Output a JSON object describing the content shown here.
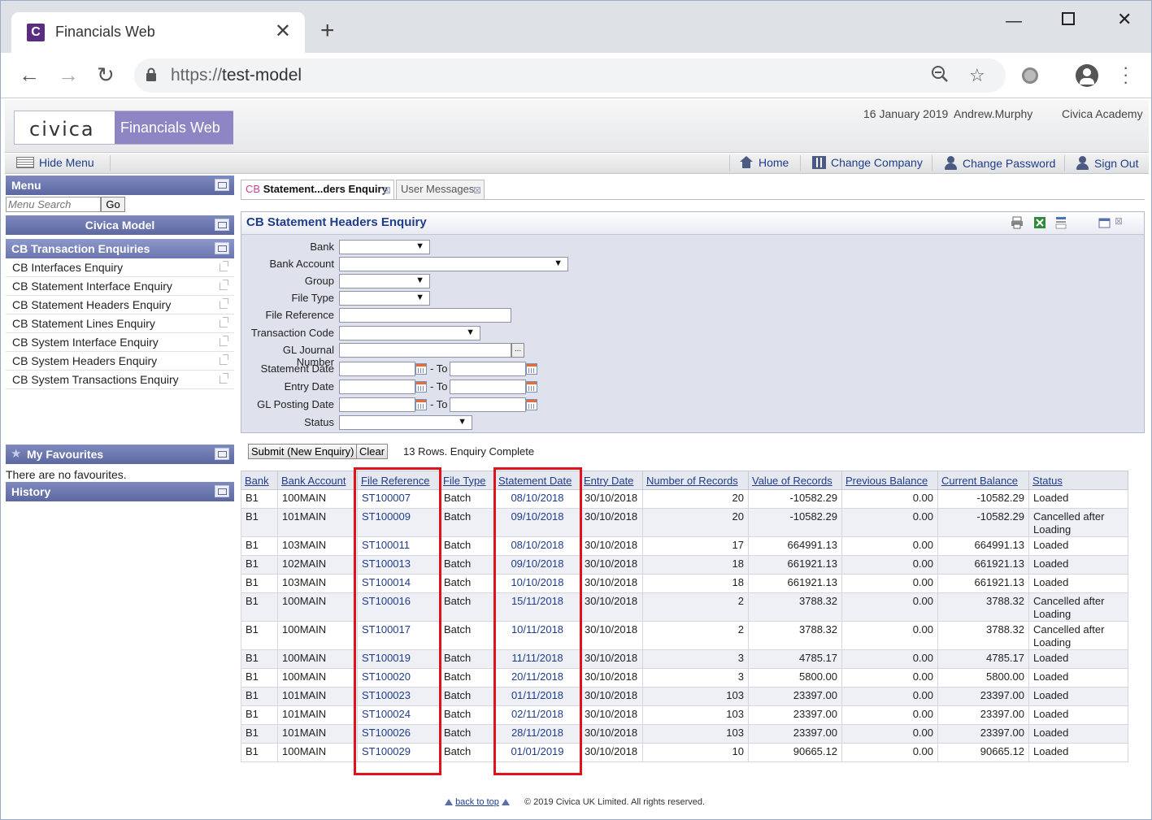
{
  "browser": {
    "tab_title": "Financials Web",
    "favicon_letter": "C",
    "url_scheme": "https://",
    "url_host": "test-model"
  },
  "app": {
    "logo_text": "civica",
    "product": "Financials Web",
    "date": "16 January 2019",
    "user": "Andrew.Murphy",
    "company": "Civica Academy"
  },
  "toolbar": {
    "hide_menu": "Hide Menu",
    "home": "Home",
    "change_company": "Change Company",
    "change_password": "Change Password",
    "sign_out": "Sign Out"
  },
  "sidebar": {
    "menu_title": "Menu",
    "search_placeholder": "Menu Search",
    "go": "Go",
    "section_model": "Civica Model",
    "section_enquiries": "CB Transaction Enquiries",
    "items": [
      "CB Interfaces Enquiry",
      "CB Statement Interface Enquiry",
      "CB Statement Headers Enquiry",
      "CB Statement Lines Enquiry",
      "CB System Interface Enquiry",
      "CB System Headers Enquiry",
      "CB System Transactions Enquiry"
    ],
    "favourites_title": "My Favourites",
    "favourites_empty": "There are no favourites.",
    "history_title": "History"
  },
  "tabs": {
    "active_prefix": "CB",
    "active_label": "Statement...ders Enquiry",
    "messages": "User Messages"
  },
  "enquiry": {
    "title": "CB Statement Headers Enquiry",
    "labels": {
      "bank": "Bank",
      "bank_account": "Bank Account",
      "group": "Group",
      "file_type": "File Type",
      "file_reference": "File Reference",
      "transaction_code": "Transaction Code",
      "gl_journal": "GL Journal Number",
      "statement_date": "Statement Date",
      "entry_date": "Entry Date",
      "gl_posting_date": "GL Posting Date",
      "status": "Status",
      "to": "- To"
    },
    "submit": "Submit (New Enquiry)",
    "clear": "Clear",
    "result_message": "13 Rows. Enquiry Complete"
  },
  "table": {
    "headers": [
      "Bank",
      "Bank Account",
      "File Reference",
      "File Type",
      "Statement Date",
      "Entry Date",
      "Number of Records",
      "Value of Records",
      "Previous Balance",
      "Current Balance",
      "Status"
    ],
    "rows": [
      [
        "B1",
        "100MAIN",
        "ST100007",
        "Batch",
        "08/10/2018",
        "30/10/2018",
        "20",
        "-10582.29",
        "0.00",
        "-10582.29",
        "Loaded"
      ],
      [
        "B1",
        "101MAIN",
        "ST100009",
        "Batch",
        "09/10/2018",
        "30/10/2018",
        "20",
        "-10582.29",
        "0.00",
        "-10582.29",
        "Cancelled after Loading"
      ],
      [
        "B1",
        "103MAIN",
        "ST100011",
        "Batch",
        "08/10/2018",
        "30/10/2018",
        "17",
        "664991.13",
        "0.00",
        "664991.13",
        "Loaded"
      ],
      [
        "B1",
        "102MAIN",
        "ST100013",
        "Batch",
        "09/10/2018",
        "30/10/2018",
        "18",
        "661921.13",
        "0.00",
        "661921.13",
        "Loaded"
      ],
      [
        "B1",
        "103MAIN",
        "ST100014",
        "Batch",
        "10/10/2018",
        "30/10/2018",
        "18",
        "661921.13",
        "0.00",
        "661921.13",
        "Loaded"
      ],
      [
        "B1",
        "100MAIN",
        "ST100016",
        "Batch",
        "15/11/2018",
        "30/10/2018",
        "2",
        "3788.32",
        "0.00",
        "3788.32",
        "Cancelled after Loading"
      ],
      [
        "B1",
        "100MAIN",
        "ST100017",
        "Batch",
        "10/11/2018",
        "30/10/2018",
        "2",
        "3788.32",
        "0.00",
        "3788.32",
        "Cancelled after Loading"
      ],
      [
        "B1",
        "100MAIN",
        "ST100019",
        "Batch",
        "11/11/2018",
        "30/10/2018",
        "3",
        "4785.17",
        "0.00",
        "4785.17",
        "Loaded"
      ],
      [
        "B1",
        "100MAIN",
        "ST100020",
        "Batch",
        "20/11/2018",
        "30/10/2018",
        "3",
        "5800.00",
        "0.00",
        "5800.00",
        "Loaded"
      ],
      [
        "B1",
        "101MAIN",
        "ST100023",
        "Batch",
        "01/11/2018",
        "30/10/2018",
        "103",
        "23397.00",
        "0.00",
        "23397.00",
        "Loaded"
      ],
      [
        "B1",
        "101MAIN",
        "ST100024",
        "Batch",
        "02/11/2018",
        "30/10/2018",
        "103",
        "23397.00",
        "0.00",
        "23397.00",
        "Loaded"
      ],
      [
        "B1",
        "101MAIN",
        "ST100026",
        "Batch",
        "28/11/2018",
        "30/10/2018",
        "103",
        "23397.00",
        "0.00",
        "23397.00",
        "Loaded"
      ],
      [
        "B1",
        "100MAIN",
        "ST100029",
        "Batch",
        "01/01/2019",
        "30/10/2018",
        "10",
        "90665.12",
        "0.00",
        "90665.12",
        "Loaded"
      ]
    ]
  },
  "footer": {
    "back_to_top": "back to top",
    "copyright": "© 2019 Civica UK Limited. All rights reserved."
  },
  "colors": {
    "highlight": "#e0131d",
    "panel_header": "#5c689f",
    "link": "#1f3d8a"
  }
}
